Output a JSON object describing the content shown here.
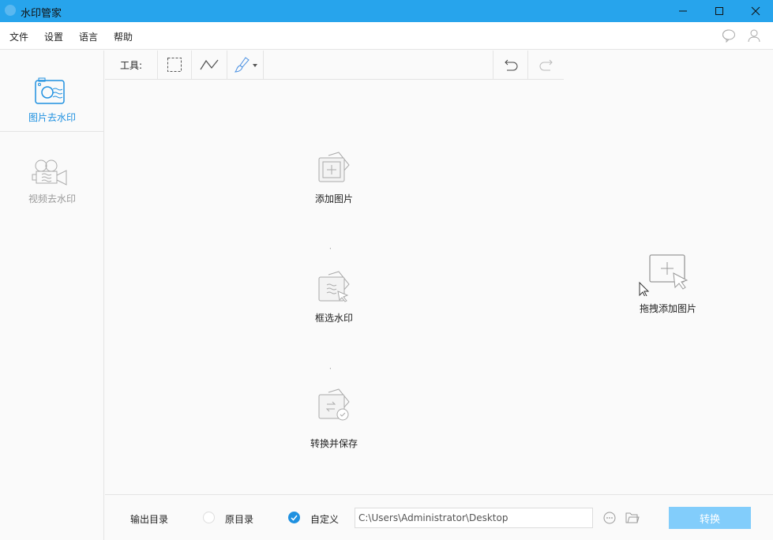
{
  "window": {
    "title": "水印管家"
  },
  "menu": [
    "文件",
    "设置",
    "语言",
    "帮助"
  ],
  "sidebar": {
    "items": [
      {
        "label": "图片去水印",
        "active": true
      },
      {
        "label": "视频去水印",
        "active": false
      }
    ]
  },
  "toolbar": {
    "label": "工具:"
  },
  "steps": [
    "添加图片",
    "框选水印",
    "转换并保存"
  ],
  "dropzone": {
    "label": "拖拽添加图片"
  },
  "bottom": {
    "output_label": "输出目录",
    "option_original": "原目录",
    "option_custom": "自定义",
    "selected": "自定义",
    "path": "C:\\Users\\Administrator\\Desktop",
    "convert_label": "转换"
  },
  "colors": {
    "accent": "#27a4ec",
    "button": "#82cdfb"
  }
}
